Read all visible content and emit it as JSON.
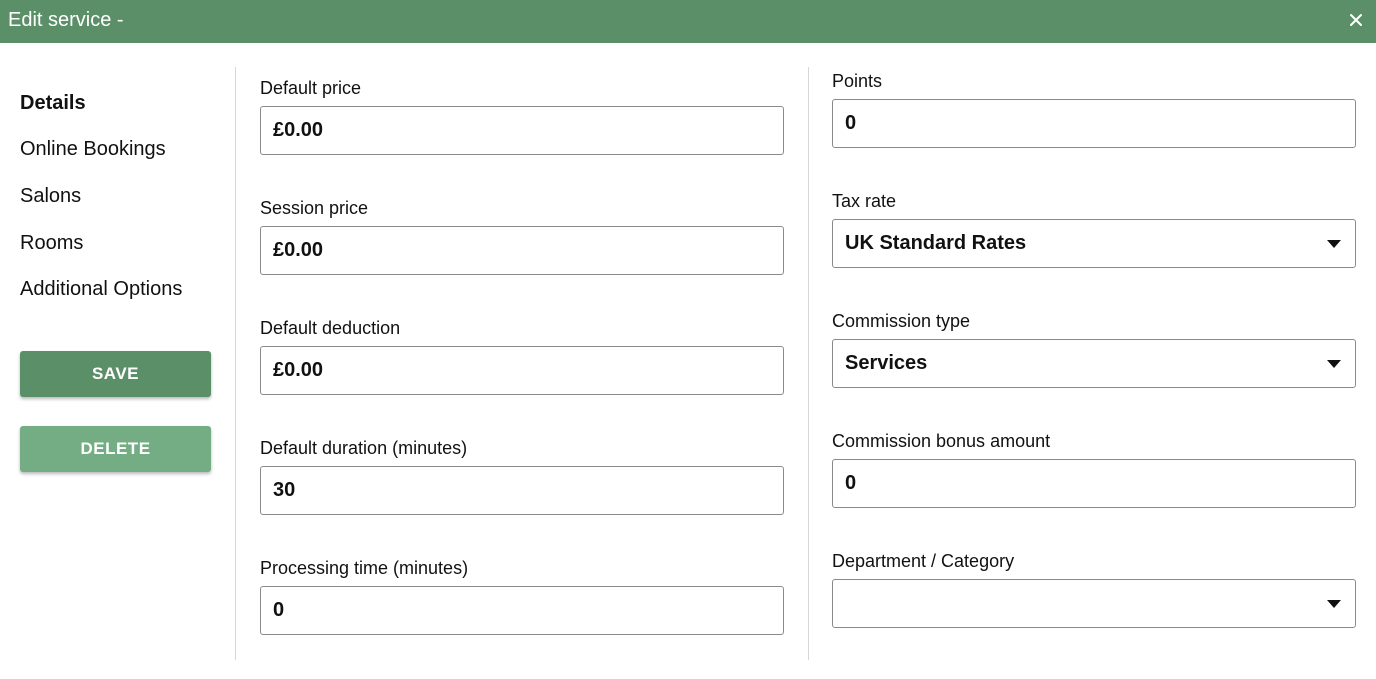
{
  "window": {
    "title": "Edit service -"
  },
  "sidebar": {
    "items": [
      {
        "label": "Details",
        "active": true
      },
      {
        "label": "Online Bookings",
        "active": false
      },
      {
        "label": "Salons",
        "active": false
      },
      {
        "label": "Rooms",
        "active": false
      },
      {
        "label": "Additional Options",
        "active": false
      }
    ],
    "save_label": "SAVE",
    "delete_label": "DELETE"
  },
  "form": {
    "default_price": {
      "label": "Default price",
      "value": "£0.00"
    },
    "session_price": {
      "label": "Session price",
      "value": "£0.00"
    },
    "default_deduction": {
      "label": "Default deduction",
      "value": "£0.00"
    },
    "default_duration": {
      "label": "Default duration (minutes)",
      "value": "30"
    },
    "processing_time": {
      "label": "Processing time (minutes)",
      "value": "0"
    },
    "points": {
      "label": "Points",
      "value": "0"
    },
    "tax_rate": {
      "label": "Tax rate",
      "value": "UK Standard Rates"
    },
    "commission_type": {
      "label": "Commission type",
      "value": "Services"
    },
    "commission_bonus": {
      "label": "Commission bonus amount",
      "value": "0"
    },
    "department": {
      "label": "Department / Category",
      "value": ""
    }
  },
  "icons": {
    "close": "close-icon",
    "dropdown": "caret-down-icon"
  },
  "colors": {
    "header": "#5b8f68",
    "save_button": "#5b8f68",
    "delete_button": "#74ad83"
  }
}
